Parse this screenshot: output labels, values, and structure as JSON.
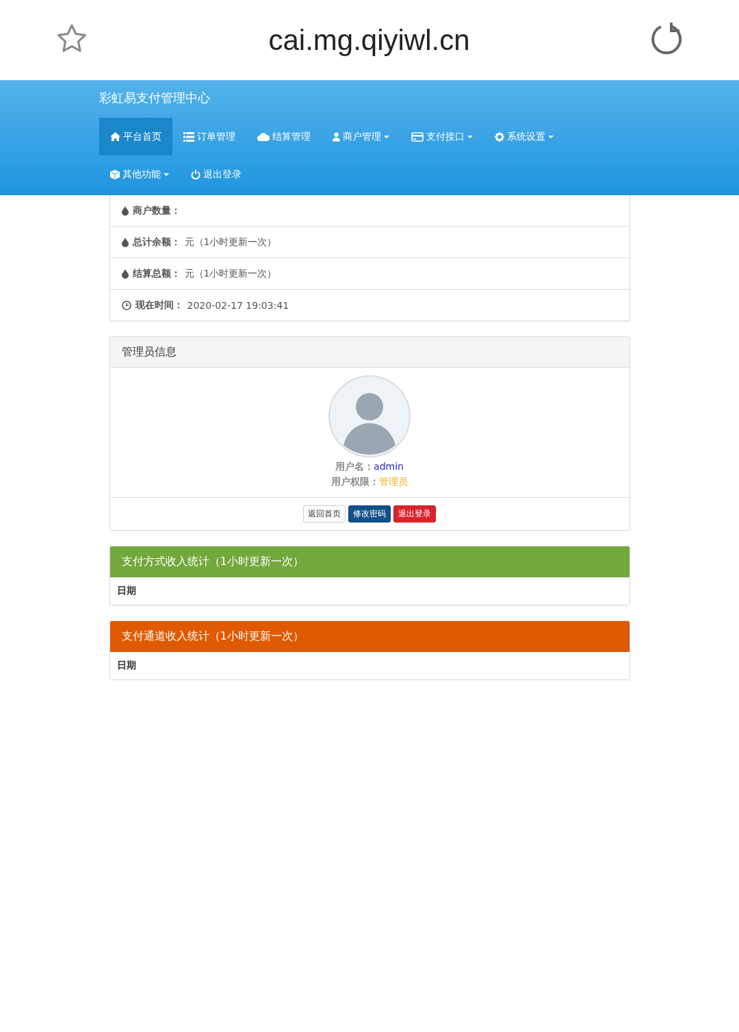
{
  "browser": {
    "url": "cai.mg.qiyiwl.cn"
  },
  "navbar": {
    "brand": "彩虹易支付管理中心",
    "items": [
      {
        "kind": "home",
        "label": "平台首页",
        "dropdown": false,
        "selected": true
      },
      {
        "kind": "list",
        "label": "订单管理",
        "dropdown": false,
        "selected": false
      },
      {
        "kind": "cloud",
        "label": "结算管理",
        "dropdown": false,
        "selected": false
      },
      {
        "kind": "user",
        "label": "商户管理",
        "dropdown": true,
        "selected": false
      },
      {
        "kind": "card",
        "label": "支付接口",
        "dropdown": true,
        "selected": false
      },
      {
        "kind": "gear",
        "label": "系统设置",
        "dropdown": true,
        "selected": false
      },
      {
        "kind": "cube",
        "label": "其他功能",
        "dropdown": true,
        "selected": false
      },
      {
        "kind": "power",
        "label": "退出登录",
        "dropdown": false,
        "selected": false
      }
    ]
  },
  "stats": [
    {
      "kind": "drop",
      "label": "商户数量："
    },
    {
      "kind": "drop",
      "label": "总计余额：",
      "value": "元（1小时更新一次）"
    },
    {
      "kind": "drop",
      "label": "结算总额：",
      "value": "元（1小时更新一次）"
    },
    {
      "kind": "clock",
      "label": "现在时间：",
      "value": "2020-02-17 19:03:41"
    }
  ],
  "admin_panel": {
    "title": "管理员信息",
    "username_label": "用户名：",
    "username": "admin",
    "role_label": "用户权限：",
    "role": "管理员",
    "buttons": [
      {
        "kind": "default",
        "label": "返回首页"
      },
      {
        "kind": "primary",
        "label": "修改密码"
      },
      {
        "kind": "danger",
        "label": "退出登录"
      }
    ]
  },
  "income_panels": [
    {
      "kind": "success",
      "title": "支付方式收入统计（1小时更新一次）",
      "column": "日期"
    },
    {
      "kind": "warning",
      "title": "支付通道收入统计（1小时更新一次）",
      "column": "日期"
    }
  ]
}
